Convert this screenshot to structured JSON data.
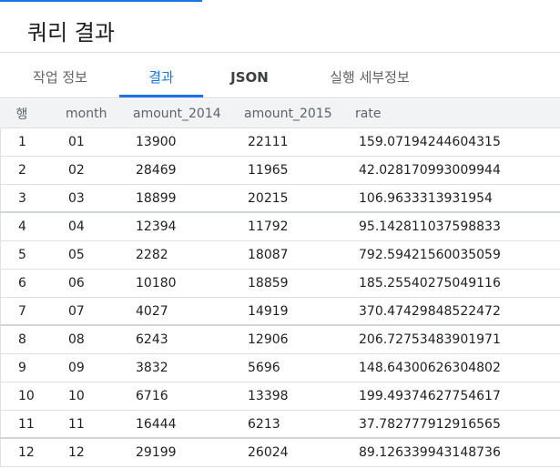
{
  "title": "쿼리 결과",
  "tabs": [
    {
      "label": "작업 정보"
    },
    {
      "label": "결과"
    },
    {
      "label": "JSON"
    },
    {
      "label": "실행 세부정보"
    }
  ],
  "active_tab": "결과",
  "colors": {
    "accent": "#1a73e8",
    "header_bg": "#f1f3f4"
  },
  "table": {
    "headers": {
      "rownum": "행",
      "month": "month",
      "amount_2014": "amount_2014",
      "amount_2015": "amount_2015",
      "rate": "rate"
    },
    "rows": [
      {
        "n": "1",
        "month": "01",
        "a2014": "13900",
        "a2015": "22111",
        "rate": "159.07194244604315"
      },
      {
        "n": "2",
        "month": "02",
        "a2014": "28469",
        "a2015": "11965",
        "rate": "42.028170993009944"
      },
      {
        "n": "3",
        "month": "03",
        "a2014": "18899",
        "a2015": "20215",
        "rate": "106.9633313931954"
      },
      {
        "n": "4",
        "month": "04",
        "a2014": "12394",
        "a2015": "11792",
        "rate": "95.142811037598833"
      },
      {
        "n": "5",
        "month": "05",
        "a2014": "2282",
        "a2015": "18087",
        "rate": "792.59421560035059"
      },
      {
        "n": "6",
        "month": "06",
        "a2014": "10180",
        "a2015": "18859",
        "rate": "185.25540275049116"
      },
      {
        "n": "7",
        "month": "07",
        "a2014": "4027",
        "a2015": "14919",
        "rate": "370.47429848522472"
      },
      {
        "n": "8",
        "month": "08",
        "a2014": "6243",
        "a2015": "12906",
        "rate": "206.72753483901971"
      },
      {
        "n": "9",
        "month": "09",
        "a2014": "3832",
        "a2015": "5696",
        "rate": "148.64300626304802"
      },
      {
        "n": "10",
        "month": "10",
        "a2014": "6716",
        "a2015": "13398",
        "rate": "199.49374627754617"
      },
      {
        "n": "11",
        "month": "11",
        "a2014": "16444",
        "a2015": "6213",
        "rate": "37.782777912916565"
      },
      {
        "n": "12",
        "month": "12",
        "a2014": "29199",
        "a2015": "26024",
        "rate": "89.126339943148736"
      }
    ]
  }
}
